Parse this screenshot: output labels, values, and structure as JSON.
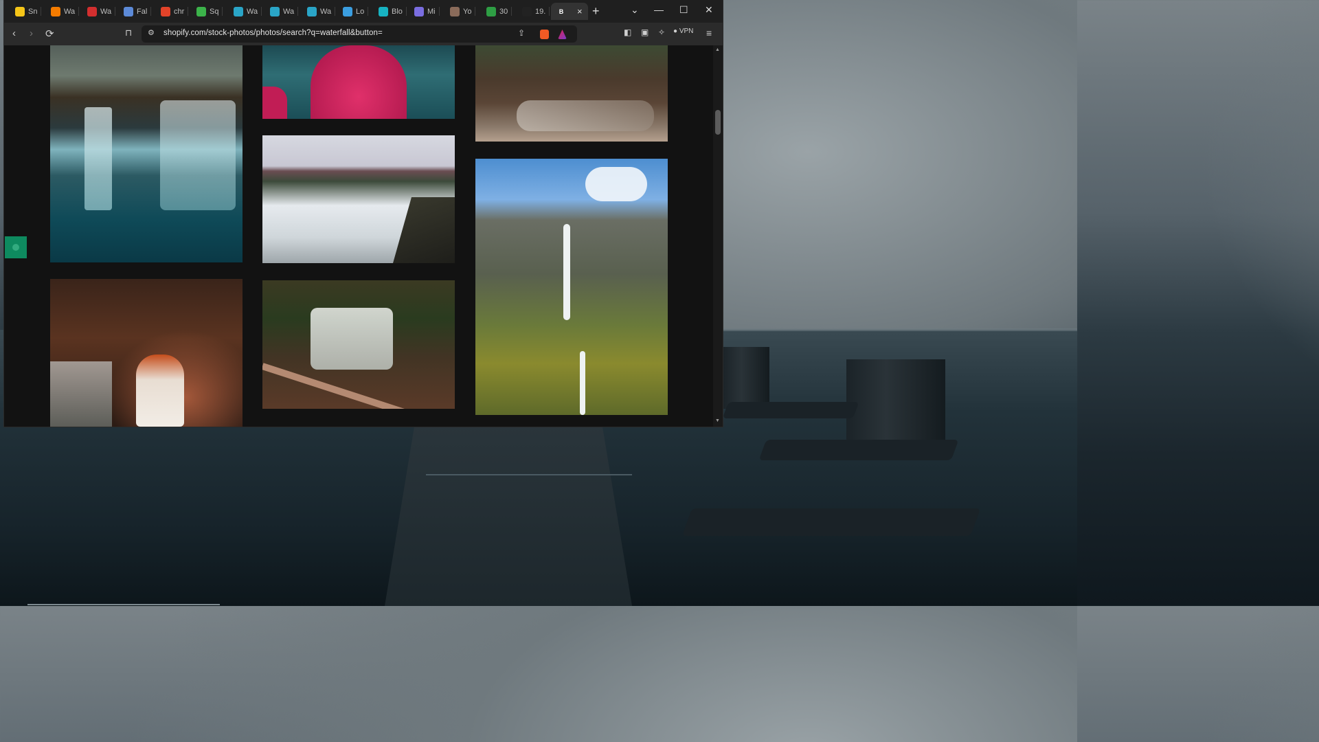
{
  "browser": {
    "tabs": [
      {
        "label": "Sn",
        "icon": "snapchat-icon",
        "color": "#f5c518"
      },
      {
        "label": "Wa",
        "icon": "hd-icon",
        "color": "#f57c00"
      },
      {
        "label": "Wa",
        "icon": "grid-red-icon",
        "color": "#d32f2f"
      },
      {
        "label": "Fal",
        "icon": "doc-icon",
        "color": "#5c8ad8"
      },
      {
        "label": "chr",
        "icon": "gitlab-icon",
        "color": "#e24329"
      },
      {
        "label": "Sq",
        "icon": "play-circle-icon",
        "color": "#3cb34a"
      },
      {
        "label": "Wa",
        "icon": "s-icon",
        "color": "#2aa5c7"
      },
      {
        "label": "Wa",
        "icon": "s-icon",
        "color": "#2aa5c7"
      },
      {
        "label": "Wa",
        "icon": "s-icon",
        "color": "#2aa5c7"
      },
      {
        "label": "Lo",
        "icon": "cloud-icon",
        "color": "#3b9ee0"
      },
      {
        "label": "Blo",
        "icon": "b-square-icon",
        "color": "#17b3c2"
      },
      {
        "label": "Mi",
        "icon": "copilot-icon",
        "color": "#7a6de0"
      },
      {
        "label": "Yo",
        "icon": "avatar-icon",
        "color": "#8a6b5a"
      },
      {
        "label": "30",
        "icon": "px-icon",
        "color": "#2e9e44"
      },
      {
        "label": "19.",
        "icon": "is-icon",
        "color": "#222222"
      },
      {
        "label": "",
        "icon": "b-icon",
        "color": "#ffffff"
      }
    ],
    "active_tab_close": "×",
    "new_tab": "+",
    "url": "shopify.com/stock-photos/photos/search?q=waterfall&button=",
    "vpn_label": "VPN"
  },
  "gallery": {
    "photos": [
      {
        "name": "photo-rocky-waterfall",
        "alt": "Long exposure waterfall over rocks"
      },
      {
        "name": "photo-red-raincoat",
        "alt": "Person in red raincoat on boat"
      },
      {
        "name": "photo-forest-creek",
        "alt": "Forest creek with fallen logs"
      },
      {
        "name": "photo-wide-falls",
        "alt": "Wide powerful waterfall"
      },
      {
        "name": "photo-mountain-falls",
        "alt": "Tall waterfall down mountainside"
      },
      {
        "name": "photo-redhead-woman",
        "alt": "Red-haired woman by waterfall"
      },
      {
        "name": "photo-hikers-falls",
        "alt": "Hikers at cascading waterfall"
      }
    ]
  }
}
